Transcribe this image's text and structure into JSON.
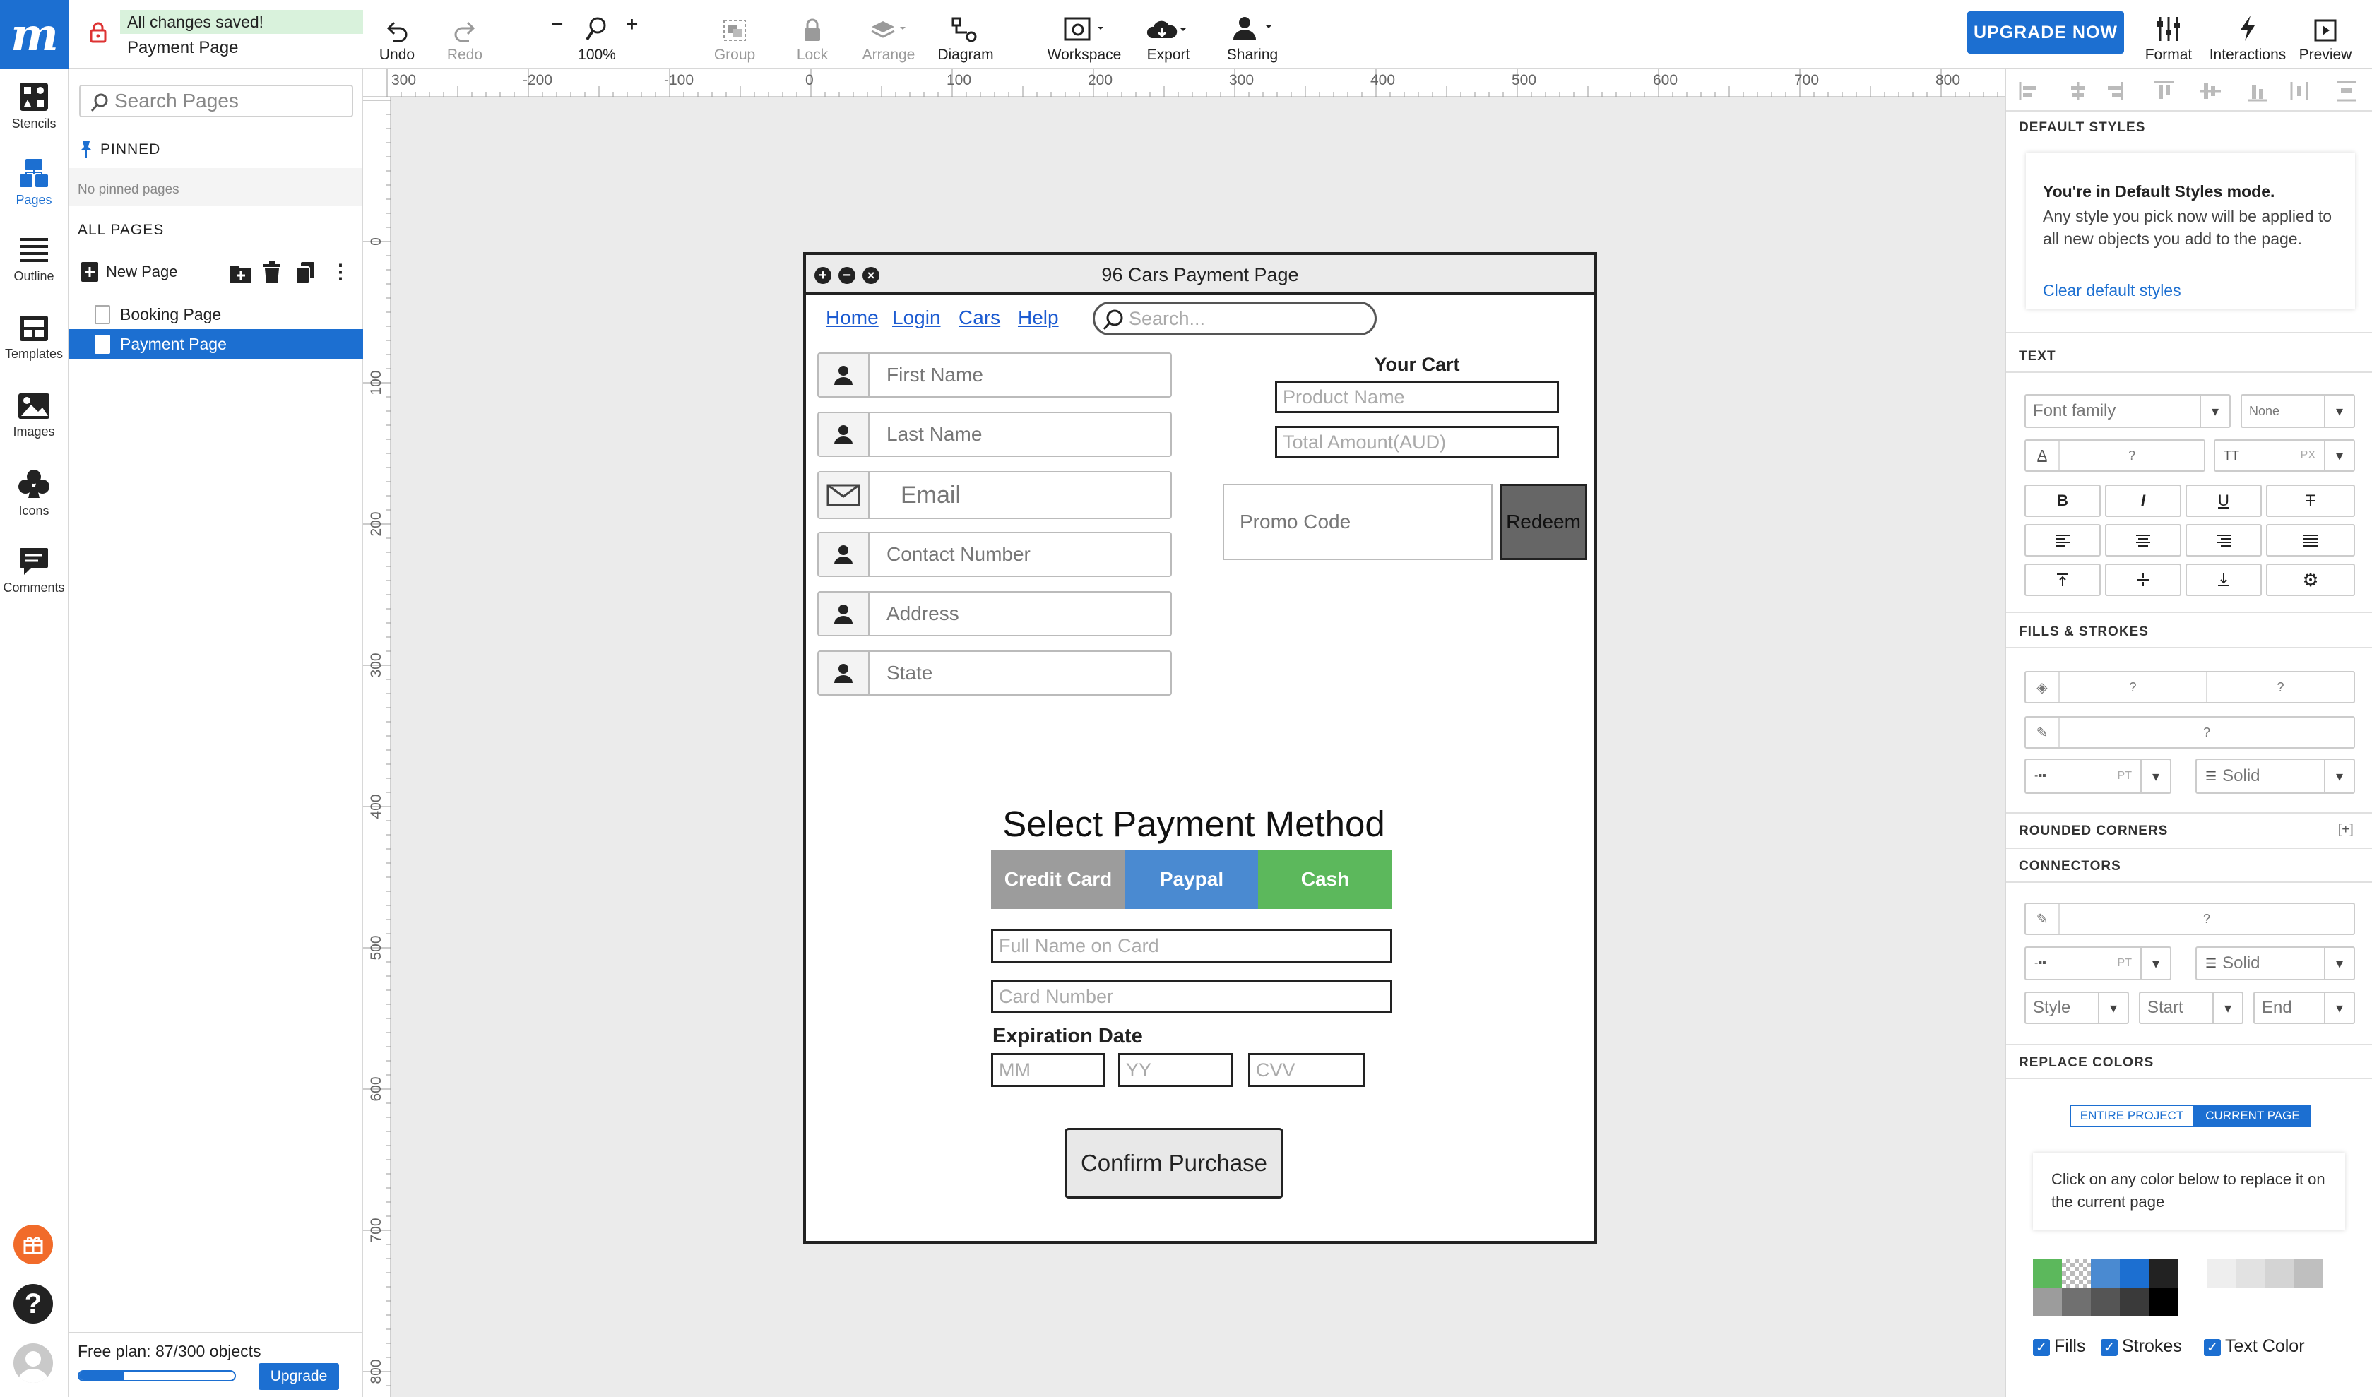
{
  "app": {
    "status": "All changes saved!",
    "page_name": "Payment Page"
  },
  "toolbar": {
    "undo": "Undo",
    "redo": "Redo",
    "zoom": "100%",
    "group": "Group",
    "lock": "Lock",
    "arrange": "Arrange",
    "diagram": "Diagram",
    "workspace": "Workspace",
    "export": "Export",
    "sharing": "Sharing",
    "upgrade_now": "UPGRADE NOW",
    "format": "Format",
    "interactions": "Interactions",
    "preview": "Preview"
  },
  "rail": {
    "stencils": "Stencils",
    "pages": "Pages",
    "outline": "Outline",
    "templates": "Templates",
    "images": "Images",
    "icons": "Icons",
    "comments": "Comments"
  },
  "pages_panel": {
    "search_placeholder": "Search Pages",
    "pinned_header": "PINNED",
    "no_pinned": "No pinned pages",
    "all_pages_header": "ALL PAGES",
    "new_page": "New Page",
    "pages": [
      "Booking Page",
      "Payment Page"
    ],
    "plan_text": "Free plan: 87/300 objects",
    "plan_progress": 0.29,
    "upgrade": "Upgrade"
  },
  "rulers": {
    "top": [
      "300",
      "-200",
      "-100",
      "0",
      "100",
      "200",
      "300",
      "400",
      "500",
      "600",
      "700",
      "800"
    ],
    "left": [
      "0",
      "100",
      "200",
      "300",
      "400",
      "500",
      "600",
      "700",
      "800"
    ]
  },
  "mockup": {
    "title": "96 Cars Payment Page",
    "nav_links": [
      "Home",
      "Login",
      "Cars",
      "Help"
    ],
    "search_placeholder": "Search...",
    "fields": [
      "First Name",
      "Last Name",
      "Email",
      "Contact Number",
      "Address",
      "State"
    ],
    "cart_title": "Your Cart",
    "product_name": "Product Name",
    "total_amount": "Total Amount(AUD)",
    "promo_code": "Promo Code",
    "redeem": "Redeem",
    "payment_heading": "Select Payment Method",
    "payment_tabs": [
      {
        "label": "Credit Card",
        "color": "#9c9c9c"
      },
      {
        "label": "Paypal",
        "color": "#4a8ad1"
      },
      {
        "label": "Cash",
        "color": "#5cb85c"
      }
    ],
    "full_name_on_card": "Full Name on Card",
    "card_number": "Card Number",
    "expiration_label": "Expiration Date",
    "mm": "MM",
    "yy": "YY",
    "cvv": "CVV",
    "confirm": "Confirm Purchase"
  },
  "right_panel": {
    "default_styles_header": "DEFAULT STYLES",
    "default_styles_title": "You're in Default Styles mode.",
    "default_styles_desc": "Any style you pick now will be applied to all new objects you add to the page.",
    "clear_default": "Clear default styles",
    "text_header": "TEXT",
    "font_family": "Font family",
    "font_none": "None",
    "q": "?",
    "px": "PX",
    "pt": "PT",
    "fills_header": "FILLS & STROKES",
    "solid": "Solid",
    "rounded_header": "ROUNDED CORNERS",
    "rounded_add": "[+]",
    "connectors_header": "CONNECTORS",
    "style": "Style",
    "start": "Start",
    "end": "End",
    "replace_header": "REPLACE COLORS",
    "entire_project": "ENTIRE PROJECT",
    "current_page": "CURRENT PAGE",
    "replace_hint": "Click on any color below to replace it on the current page",
    "swatches_row1": [
      "#5cb85c",
      "checker",
      "#4a8ad1",
      "#1c6fd1",
      "#222222",
      "#ffffff",
      "#eeeeee",
      "#e2e2e2",
      "#d4d4d4",
      "#bfbfbf"
    ],
    "swatches_row2": [
      "#9c9c9c",
      "#707070",
      "#555555",
      "#3a3a3a",
      "#000000"
    ],
    "fills": "Fills",
    "strokes": "Strokes",
    "text_color": "Text Color"
  },
  "colors": {
    "accent": "#1c6fd1",
    "saved_bg": "#d9f2dc"
  }
}
